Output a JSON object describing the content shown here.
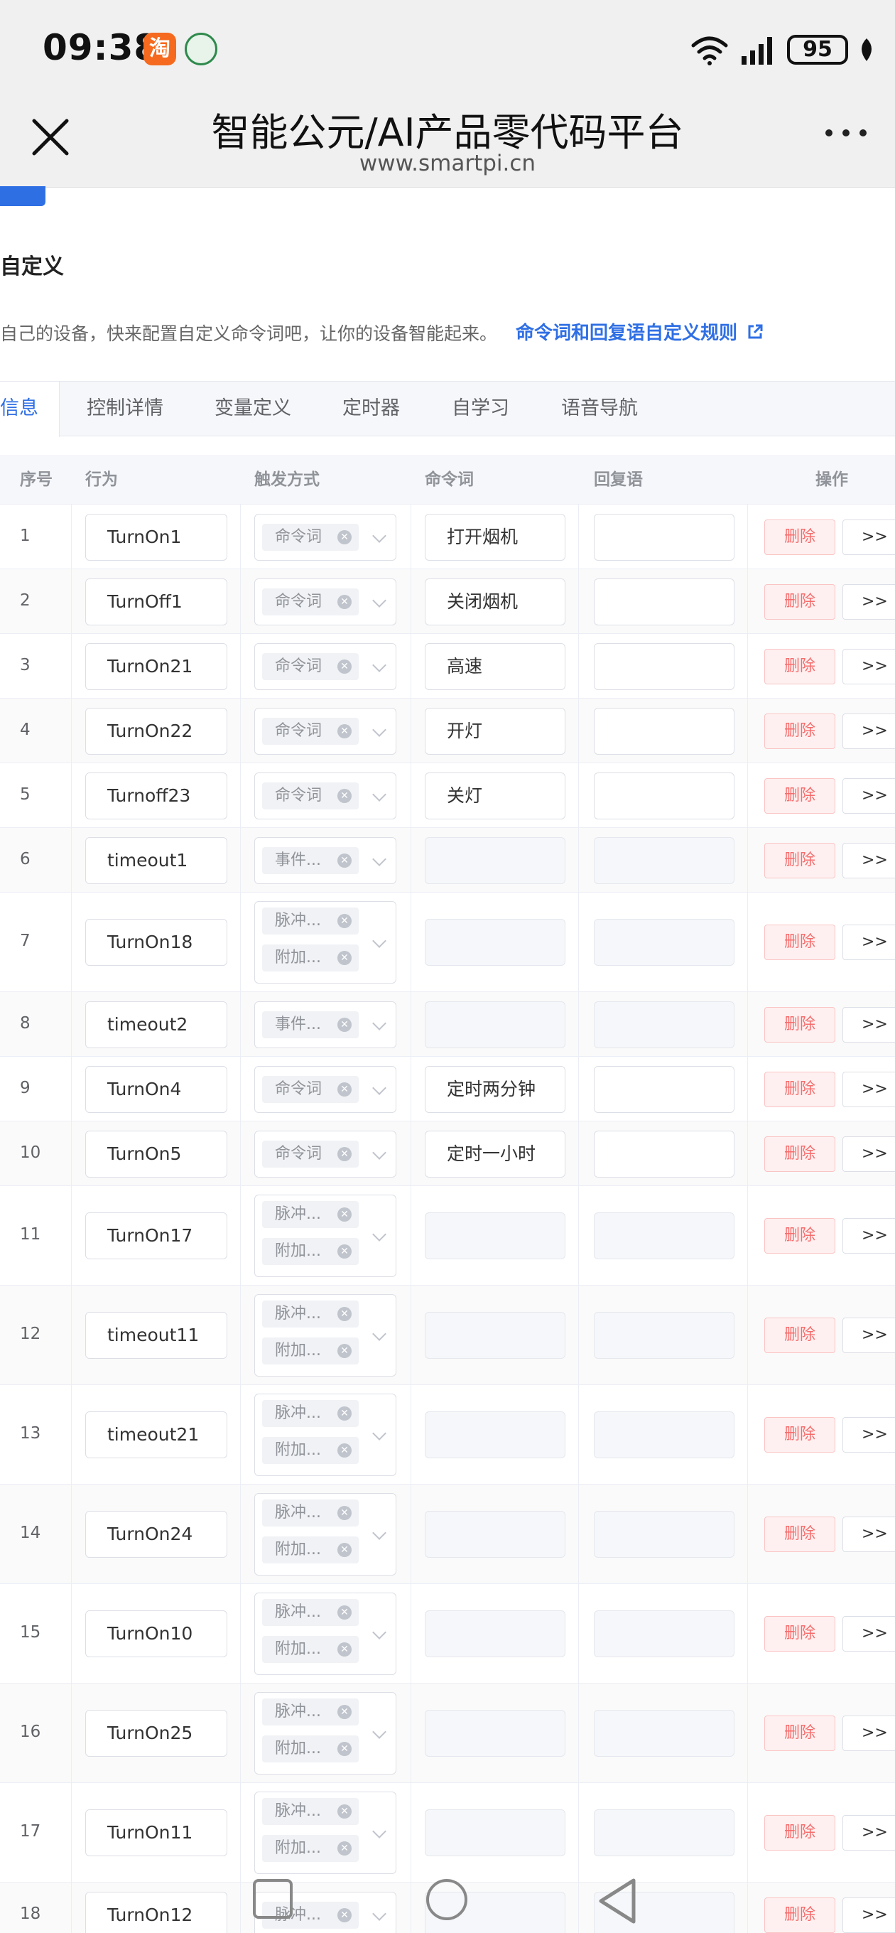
{
  "status_bar": {
    "time": "09:38",
    "app_badge": "淘",
    "battery": "95"
  },
  "title_bar": {
    "title": "智能公元/AI产品零代码平台",
    "url": "www.smartpi.cn"
  },
  "section": {
    "title": "自定义",
    "description": "自己的设备，快来配置自定义命令词吧，让你的设备智能起来。",
    "rule_link": "命令词和回复语自定义规则"
  },
  "tabs": [
    "信息",
    "控制详情",
    "变量定义",
    "定时器",
    "自学习",
    "语音导航"
  ],
  "active_tab": "信息",
  "table": {
    "headers": {
      "index": "序号",
      "action": "行为",
      "trigger": "触发方式",
      "command": "命令词",
      "reply": "回复语",
      "ops": "操作"
    },
    "delete_label": "删除",
    "more_label": ">>",
    "rows": [
      {
        "index": "1",
        "action": "TurnOn1",
        "tags": [
          "命令词"
        ],
        "command": "打开烟机",
        "command_enabled": true
      },
      {
        "index": "2",
        "action": "TurnOff1",
        "tags": [
          "命令词"
        ],
        "command": "关闭烟机",
        "command_enabled": true
      },
      {
        "index": "3",
        "action": "TurnOn21",
        "tags": [
          "命令词"
        ],
        "command": "高速",
        "command_enabled": true
      },
      {
        "index": "4",
        "action": "TurnOn22",
        "tags": [
          "命令词"
        ],
        "command": "开灯",
        "command_enabled": true
      },
      {
        "index": "5",
        "action": "Turnoff23",
        "tags": [
          "命令词"
        ],
        "command": "关灯",
        "command_enabled": true
      },
      {
        "index": "6",
        "action": "timeout1",
        "tags": [
          "事件..."
        ],
        "command": "",
        "command_enabled": false
      },
      {
        "index": "7",
        "action": "TurnOn18",
        "tags": [
          "脉冲...",
          "附加..."
        ],
        "command": "",
        "command_enabled": false
      },
      {
        "index": "8",
        "action": "timeout2",
        "tags": [
          "事件..."
        ],
        "command": "",
        "command_enabled": false
      },
      {
        "index": "9",
        "action": "TurnOn4",
        "tags": [
          "命令词"
        ],
        "command": "定时两分钟",
        "command_enabled": true
      },
      {
        "index": "10",
        "action": "TurnOn5",
        "tags": [
          "命令词"
        ],
        "command": "定时一小时",
        "command_enabled": true
      },
      {
        "index": "11",
        "action": "TurnOn17",
        "tags": [
          "脉冲...",
          "附加..."
        ],
        "command": "",
        "command_enabled": false
      },
      {
        "index": "12",
        "action": "timeout11",
        "tags": [
          "脉冲...",
          "附加..."
        ],
        "command": "",
        "command_enabled": false
      },
      {
        "index": "13",
        "action": "timeout21",
        "tags": [
          "脉冲...",
          "附加..."
        ],
        "command": "",
        "command_enabled": false
      },
      {
        "index": "14",
        "action": "TurnOn24",
        "tags": [
          "脉冲...",
          "附加..."
        ],
        "command": "",
        "command_enabled": false
      },
      {
        "index": "15",
        "action": "TurnOn10",
        "tags": [
          "脉冲...",
          "附加..."
        ],
        "command": "",
        "command_enabled": false
      },
      {
        "index": "16",
        "action": "TurnOn25",
        "tags": [
          "脉冲...",
          "附加..."
        ],
        "command": "",
        "command_enabled": false
      },
      {
        "index": "17",
        "action": "TurnOn11",
        "tags": [
          "脉冲...",
          "附加..."
        ],
        "command": "",
        "command_enabled": false
      },
      {
        "index": "18",
        "action": "TurnOn12",
        "tags": [
          "脉冲..."
        ],
        "command": "",
        "command_enabled": false
      }
    ]
  },
  "colors": {
    "accent": "#2f6fe4",
    "danger": "#f56c6c",
    "taobao": "#f56a1e"
  },
  "icons": [
    "close-icon",
    "more-icon",
    "external-link-icon",
    "wifi-icon",
    "signal-icon",
    "leaf-icon",
    "tag-close-icon",
    "chevron-down-icon"
  ]
}
